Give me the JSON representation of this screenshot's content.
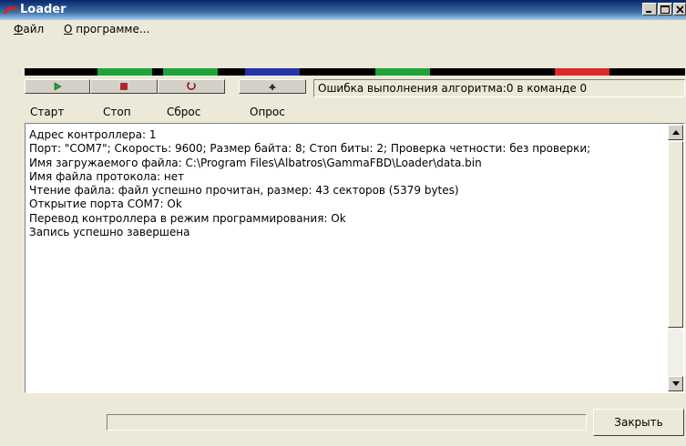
{
  "window": {
    "title": "Loader",
    "icon": "red-arc-icon"
  },
  "menu": [
    {
      "prefix": "",
      "accel": "Ф",
      "rest": "айл"
    },
    {
      "prefix": "",
      "accel": "О",
      "rest": " программе..."
    }
  ],
  "status_strip": {
    "background": "#000000",
    "segments": [
      {
        "color": "#1fa23a",
        "name": "green"
      },
      {
        "color": "#1fa23a",
        "name": "green"
      },
      {
        "color": "#2832a8",
        "name": "blue"
      },
      {
        "color": "#1fa23a",
        "name": "green"
      },
      {
        "color": "#e02828",
        "name": "red"
      }
    ]
  },
  "toolbar": {
    "start_label": "Старт",
    "stop_label": "Стоп",
    "reset_label": "Сброс",
    "poll_label": "Опрос",
    "status_message": "Ошибка выполнения алгоритма:0 в команде 0"
  },
  "log": {
    "lines": [
      "Адрес контроллера: 1",
      "Порт: \"COM7\"; Скорость: 9600; Размер байта: 8; Стоп биты: 2; Проверка четности: без проверки;",
      "Имя загружаемого файла: C:\\Program Files\\Albatros\\GammaFBD\\Loader\\data.bin",
      "Имя файла протокола: нет",
      "Чтение файла: файл успешно прочитан, размер: 43 секторов (5379 bytes)",
      "Открытие порта COM7: Ok",
      "Перевод контроллера в режим программирования:  Ok",
      "Запись успешно завершена"
    ]
  },
  "footer": {
    "close_label": "Закрыть",
    "progress": 0
  },
  "colors": {
    "window_bg": "#ece9d8",
    "title_start": "#0a246a",
    "title_end": "#a6caf0",
    "play_green": "#1fa23a",
    "stop_red": "#c02020"
  }
}
